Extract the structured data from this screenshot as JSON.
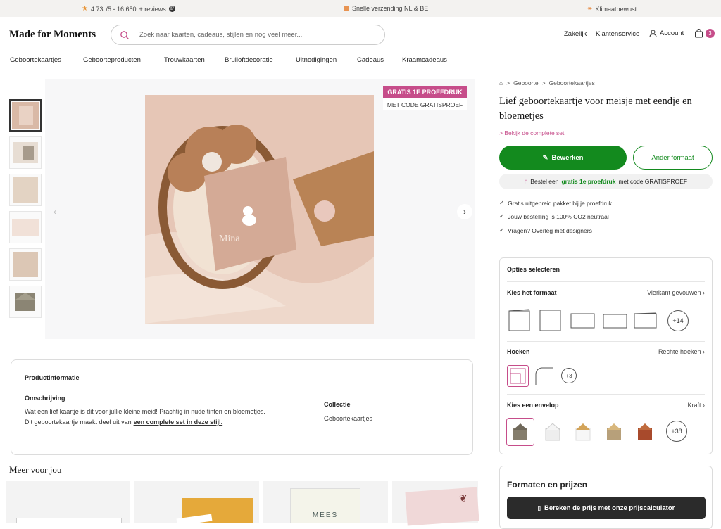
{
  "topbar": {
    "rating": "4.73",
    "rating_suffix": "/5 - 16.650",
    "reviews": "+ reviews",
    "shipping": "Snelle verzending NL & BE",
    "climate": "Klimaatbewust"
  },
  "header": {
    "logo": "Made for Moments",
    "search_placeholder": "Zoek naar kaarten, cadeaus, stijlen en nog veel meer...",
    "zakelijk": "Zakelijk",
    "klantenservice": "Klantenservice",
    "account": "Account",
    "cart_count": "3"
  },
  "nav": [
    "Geboortekaartjes",
    "Geboorteproducten",
    "Trouwkaarten",
    "Bruiloftdecoratie",
    "Uitnodigingen",
    "Cadeaus",
    "Kraamcadeaus"
  ],
  "gallery": {
    "badge_main": "GRATIS 1E PROEFDRUK",
    "badge_sub": "MET CODE GRATISPROEF"
  },
  "breadcrumb": {
    "level1": "Geboorte",
    "level2": "Geboortekaartjes"
  },
  "product": {
    "title": "Lief geboortekaartje voor meisje met eendje en bloemetjes",
    "set_link": "> Bekijk de complete set",
    "edit_label": "Bewerken",
    "format_label": "Ander formaat",
    "promo_pre": "Bestel een",
    "promo_green": "gratis 1e proefdruk",
    "promo_post": "met code GRATISPROEF"
  },
  "usps": [
    "Gratis uitgebreid pakket bij je proefdruk",
    "Jouw bestelling is 100% CO2 neutraal",
    "Vragen? Overleg met designers"
  ],
  "options": {
    "title": "Opties selecteren",
    "format_label": "Kies het formaat",
    "format_value": "Vierkant gevouwen",
    "format_more": "+14",
    "corners_label": "Hoeken",
    "corners_value": "Rechte hoeken",
    "corners_more": "+3",
    "envelope_label": "Kies een envelop",
    "envelope_value": "Kraft",
    "envelope_more": "+38"
  },
  "pricing": {
    "title": "Formaten en prijzen",
    "calc_label": "Bereken de prijs met onze prijscalculator"
  },
  "info": {
    "title": "Productinformatie",
    "desc_title": "Omschrijving",
    "desc_line1": "Wat een lief kaartje is dit voor jullie kleine meid! Prachtig in nude tinten en bloemetjes.",
    "desc_line2_pre": "Dit geboortekaartje maakt deel uit van",
    "desc_link": "een complete set in deze stijl.",
    "collectie_title": "Collectie",
    "collectie_value": "Geboortekaartjes"
  },
  "more": {
    "title": "Meer voor jou",
    "card_text": "MEES"
  },
  "colors": {
    "accent_pink": "#c64d8a",
    "accent_green": "#138a1e",
    "dark": "#2b2b2b"
  }
}
